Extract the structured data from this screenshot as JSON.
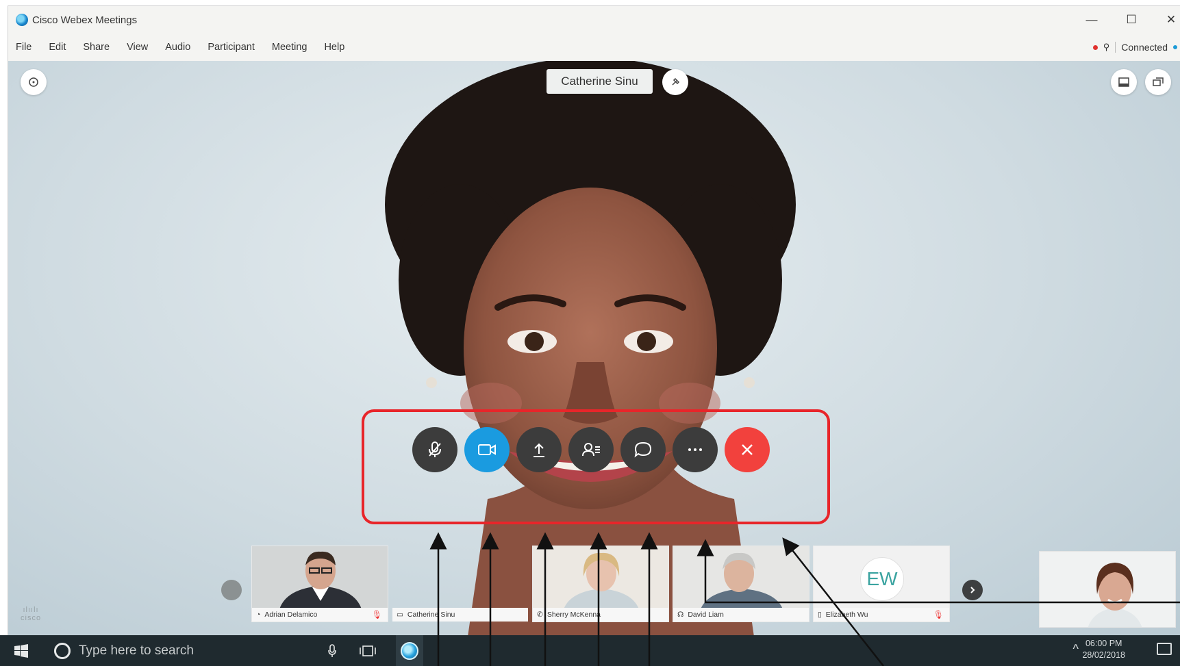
{
  "window": {
    "title": "Cisco Webex Meetings",
    "controls": [
      "—",
      "☐",
      "✕"
    ]
  },
  "menu": [
    "File",
    "Edit",
    "Share",
    "View",
    "Audio",
    "Participant",
    "Meeting",
    "Help"
  ],
  "status": {
    "text": "Connected"
  },
  "meeting": {
    "active_speaker": "Catherine Sinu"
  },
  "controls": [
    {
      "id": "mute",
      "icon": "mic-muted-icon"
    },
    {
      "id": "video",
      "icon": "video-camera-icon"
    },
    {
      "id": "share",
      "icon": "share-upload-icon"
    },
    {
      "id": "participants",
      "icon": "participants-icon"
    },
    {
      "id": "chat",
      "icon": "chat-bubble-icon"
    },
    {
      "id": "more",
      "icon": "more-options-icon"
    },
    {
      "id": "leave",
      "icon": "end-call-icon"
    }
  ],
  "participants": [
    {
      "name": "Adrian Delamico",
      "muted": true
    },
    {
      "name": "Catherine Sinu",
      "muted": false
    },
    {
      "name": "Sherry McKenna",
      "muted": false
    },
    {
      "name": "David Liam",
      "muted": false
    },
    {
      "name": "Elizabeth Wu",
      "muted": true,
      "initials": "EW"
    }
  ],
  "branding": {
    "logo": "cisco"
  },
  "taskbar": {
    "search_placeholder": "Type here to search",
    "time": "06:00 PM",
    "date": "28/02/2018"
  },
  "colors": {
    "accent": "#1a9be0",
    "leave": "#f2413d",
    "highlight_box": "#e8252a"
  }
}
